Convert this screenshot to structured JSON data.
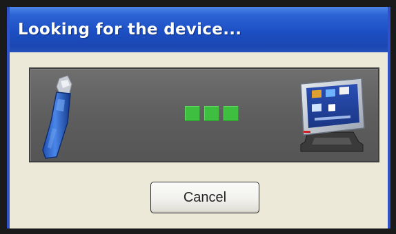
{
  "dialog": {
    "title": "Looking for the device...",
    "cancel_label": "Cancel"
  },
  "progress": {
    "source_icon": "ultrasound-probe-icon",
    "target_icon": "monitor-device-icon",
    "indicator_count": 3,
    "indicator_color": "#3fbf3f"
  },
  "colors": {
    "titlebar": "#1c4fc3",
    "dialog_background": "#ece9d8",
    "panel_background": "#5e5e5e"
  }
}
